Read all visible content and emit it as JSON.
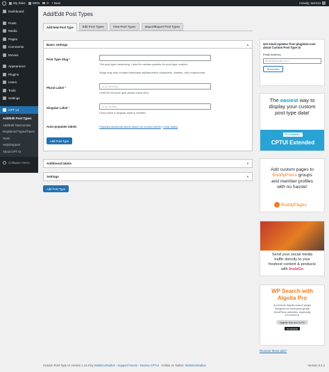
{
  "adminbar": {
    "my_sites": "My Sites",
    "site": "WDS",
    "comments": "0",
    "new": "+ New",
    "howdy": "Howdy, tw2113"
  },
  "menu": {
    "items": [
      "Dashboard",
      "Posts",
      "Media",
      "Pages",
      "Comments",
      "Movies",
      "Appearance",
      "Plugins",
      "Users",
      "Tools",
      "Settings"
    ],
    "current": "CPT UI",
    "sub": [
      "Add/Edit Post Types",
      "Add/Edit Taxonomies",
      "Registered Types/Taxes",
      "Tools",
      "Help/Support",
      "About CPT UI"
    ],
    "collapse": "Collapse menu"
  },
  "page_title": "Add/Edit Post Types",
  "tabs": [
    "Add New Post Type",
    "Edit Post Types",
    "View Post Types",
    "Import/Export Post Types"
  ],
  "basic": {
    "title": "Basic settings",
    "slug_label": "Post Type Slug",
    "slug_desc": "The post type name/slug. Used for various queries for post type content.",
    "slug_note": "Slugs may only contain lowercase alphanumeric characters, dashes, and underscores.",
    "plural_label": "Plural Label",
    "plural_placeholder": "(e.g. Movies)",
    "plural_desc": "Used for the post type admin menu item.",
    "singular_label": "Singular Label",
    "singular_placeholder": "(e.g. Movie)",
    "singular_desc": "Used when a singular label is needed.",
    "autopop_label": "Auto-populate labels",
    "autopop_link1": "Populate additional labels based on chosen labels",
    "autopop_sep": " | ",
    "autopop_link2": "Clear labels",
    "add_button": "Add Post Type"
  },
  "additional": {
    "title": "Additional labels"
  },
  "settings": {
    "title": "Settings"
  },
  "add_button_bottom": "Add Post Type",
  "sidebar": {
    "newsletter_text": "Get email updates from pluginize.com about Custom Post Type UI",
    "email_label": "Email Address",
    "email_placeholder": "email@domain.com",
    "subscribe": "Subscribe",
    "ad1": {
      "l1a": "The ",
      "l1b": "easiest",
      "l1c": " way to",
      "l2": "display your custom",
      "l3": "post type data!",
      "brand": "PLUGINIZE ▸",
      "product": "CPTUI Extended"
    },
    "ad2": {
      "l1": "Add custom pages to",
      "l2a": "BuddyPress",
      "l2b": " groups",
      "l3": "and member profiles",
      "l4": "with no hassle!",
      "brand": "BuddyPages"
    },
    "ad3": {
      "l1": "Send your social media",
      "l2": "traffic directly to your",
      "l3": "freshest content & products",
      "l4a": "with ",
      "l4b": "InstaGo"
    },
    "ad4": {
      "t1": "WP Search with",
      "t2": "Algolia Pro",
      "d1": "A premium Algolia search plugin",
      "d2": "designed for enterprise-grade",
      "d3": "WordPress websites, especially",
      "d4": "eCommerce",
      "btn": "Upgrade Now and Go Pro",
      "brand": "PLUGINIZE"
    },
    "remove_ads": "Remove these ads?"
  },
  "footer": {
    "prefix": "Custom Post Type UI version 1.14.0 by ",
    "link1": "WebDevStudios",
    "sep1": " - ",
    "link2": "Support forums",
    "sep2": " - ",
    "link3": "Review CPTUI",
    "sep3": " - Follow on Twitter: ",
    "link4": "WebDevStudios",
    "version": "Version 6.2.2"
  }
}
